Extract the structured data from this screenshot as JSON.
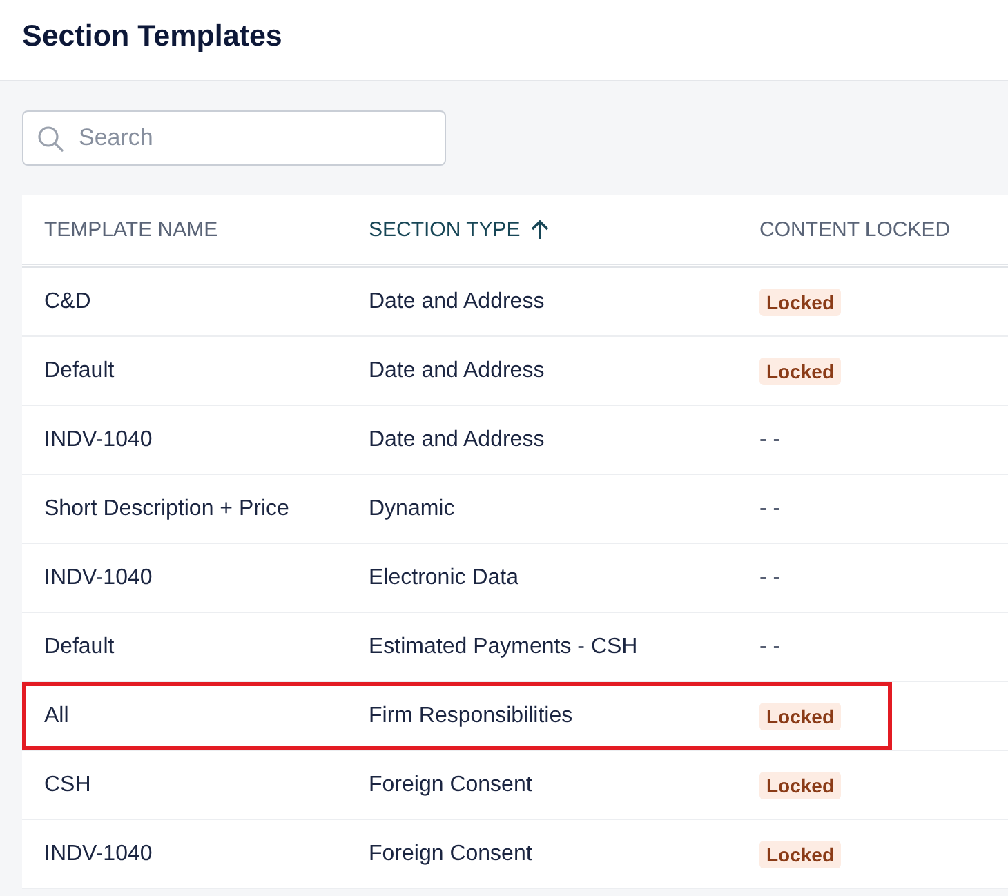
{
  "header": {
    "title": "Section Templates"
  },
  "search": {
    "placeholder": "Search"
  },
  "table": {
    "columns": [
      {
        "label": "TEMPLATE NAME",
        "sorted": false
      },
      {
        "label": "SECTION TYPE",
        "sorted": true
      },
      {
        "label": "CONTENT LOCKED",
        "sorted": false
      }
    ],
    "rows": [
      {
        "template_name": "C&D",
        "section_type": "Date and Address",
        "content_locked": {
          "text": "Locked",
          "locked": true
        },
        "highlighted": false
      },
      {
        "template_name": "Default",
        "section_type": "Date and Address",
        "content_locked": {
          "text": "Locked",
          "locked": true
        },
        "highlighted": false
      },
      {
        "template_name": "INDV-1040",
        "section_type": "Date and Address",
        "content_locked": {
          "text": "- -",
          "locked": false
        },
        "highlighted": false
      },
      {
        "template_name": "Short Description + Price",
        "section_type": "Dynamic",
        "content_locked": {
          "text": "- -",
          "locked": false
        },
        "highlighted": false
      },
      {
        "template_name": "INDV-1040",
        "section_type": "Electronic Data",
        "content_locked": {
          "text": "- -",
          "locked": false
        },
        "highlighted": false
      },
      {
        "template_name": "Default",
        "section_type": "Estimated Payments - CSH",
        "content_locked": {
          "text": "- -",
          "locked": false
        },
        "highlighted": false
      },
      {
        "template_name": "All",
        "section_type": "Firm Responsibilities",
        "content_locked": {
          "text": "Locked",
          "locked": true
        },
        "highlighted": true
      },
      {
        "template_name": "CSH",
        "section_type": "Foreign Consent",
        "content_locked": {
          "text": "Locked",
          "locked": true
        },
        "highlighted": false
      },
      {
        "template_name": "INDV-1040",
        "section_type": "Foreign Consent",
        "content_locked": {
          "text": "Locked",
          "locked": true
        },
        "highlighted": false
      }
    ]
  }
}
